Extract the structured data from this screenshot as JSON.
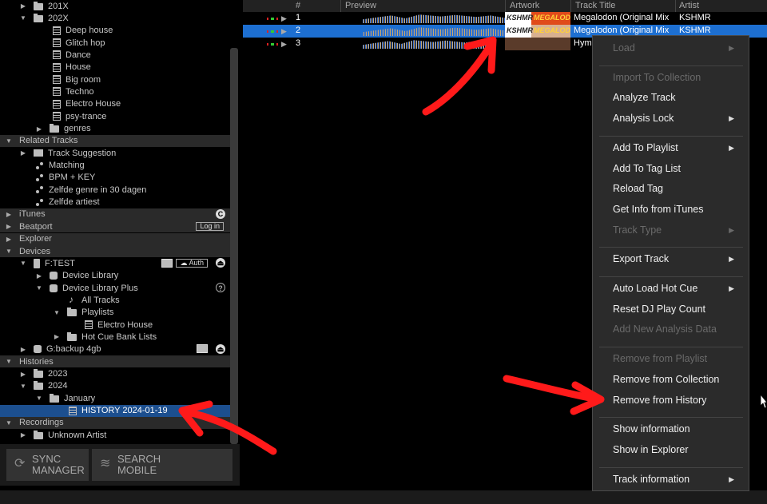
{
  "tree": {
    "rows": [
      {
        "indent": 24,
        "tri": "▶",
        "icon": "folder",
        "label": "201X"
      },
      {
        "indent": 24,
        "tri": "▼",
        "icon": "folder",
        "label": "202X"
      },
      {
        "indent": 66,
        "tri": "",
        "icon": "list",
        "label": "Deep house"
      },
      {
        "indent": 66,
        "tri": "",
        "icon": "list",
        "label": "Glitch hop"
      },
      {
        "indent": 66,
        "tri": "",
        "icon": "list",
        "label": "Dance"
      },
      {
        "indent": 66,
        "tri": "",
        "icon": "list",
        "label": "House"
      },
      {
        "indent": 66,
        "tri": "",
        "icon": "list",
        "label": "Big room"
      },
      {
        "indent": 66,
        "tri": "",
        "icon": "list",
        "label": "Techno"
      },
      {
        "indent": 66,
        "tri": "",
        "icon": "list",
        "label": "Electro House"
      },
      {
        "indent": 66,
        "tri": "",
        "icon": "list",
        "label": "psy-trance"
      },
      {
        "indent": 44,
        "tri": "▶",
        "icon": "folder",
        "label": "genres"
      },
      {
        "indent": 10,
        "tri": "▼",
        "icon": "",
        "label": "Related Tracks",
        "section": true
      },
      {
        "indent": 24,
        "tri": "▶",
        "icon": "sugg",
        "label": "Track Suggestion"
      },
      {
        "indent": 44,
        "tri": "",
        "icon": "node",
        "label": "Matching"
      },
      {
        "indent": 44,
        "tri": "",
        "icon": "node",
        "label": "BPM + KEY"
      },
      {
        "indent": 44,
        "tri": "",
        "icon": "node",
        "label": "Zelfde genre in 30 dagen"
      },
      {
        "indent": 44,
        "tri": "",
        "icon": "node",
        "label": "Zelfde artiest"
      },
      {
        "indent": 10,
        "tri": "▶",
        "icon": "",
        "label": "iTunes",
        "section": true,
        "badge": "itunes"
      },
      {
        "indent": 10,
        "tri": "▶",
        "icon": "",
        "label": "Beatport",
        "section": true,
        "badge": "login"
      },
      {
        "indent": 10,
        "tri": "▶",
        "icon": "",
        "label": "Explorer",
        "section": true
      },
      {
        "indent": 10,
        "tri": "▼",
        "icon": "",
        "label": "Devices",
        "section": true
      },
      {
        "indent": 24,
        "tri": "▼",
        "icon": "usb",
        "label": "F:TEST",
        "badge": "device"
      },
      {
        "indent": 44,
        "tri": "▶",
        "icon": "db",
        "label": "Device Library"
      },
      {
        "indent": 44,
        "tri": "▼",
        "icon": "db",
        "label": "Device Library Plus",
        "badge": "help"
      },
      {
        "indent": 86,
        "tri": "",
        "icon": "note",
        "label": "All Tracks"
      },
      {
        "indent": 66,
        "tri": "▼",
        "icon": "folder",
        "label": "Playlists"
      },
      {
        "indent": 106,
        "tri": "",
        "icon": "list",
        "label": "Electro House"
      },
      {
        "indent": 66,
        "tri": "▶",
        "icon": "folder",
        "label": "Hot Cue Bank Lists"
      },
      {
        "indent": 24,
        "tri": "▶",
        "icon": "db",
        "label": "G:backup 4gb",
        "badge": "device2"
      },
      {
        "indent": 10,
        "tri": "▼",
        "icon": "",
        "label": "Histories",
        "section": true
      },
      {
        "indent": 24,
        "tri": "▶",
        "icon": "folder",
        "label": "2023"
      },
      {
        "indent": 24,
        "tri": "▼",
        "icon": "folder",
        "label": "2024"
      },
      {
        "indent": 44,
        "tri": "▼",
        "icon": "folder",
        "label": "January"
      },
      {
        "indent": 86,
        "tri": "",
        "icon": "list",
        "label": "HISTORY 2024-01-19",
        "selected": true
      },
      {
        "indent": 10,
        "tri": "▼",
        "icon": "",
        "label": "Recordings",
        "section": true
      },
      {
        "indent": 24,
        "tri": "▶",
        "icon": "folder",
        "label": "Unknown Artist"
      }
    ],
    "login_label": "Log in",
    "auth_label": "Auth"
  },
  "bottom": {
    "sync_label_1": "SYNC",
    "sync_label_2": "MANAGER",
    "search_label_1": "SEARCH",
    "search_label_2": "MOBILE"
  },
  "table": {
    "headers": {
      "num": "#",
      "preview": "Preview",
      "artwork": "Artwork",
      "title": "Track Title",
      "artist": "Artist"
    },
    "rows": [
      {
        "num": "1",
        "title": "Megalodon (Original Mix",
        "artist": "KSHMR",
        "selected": false
      },
      {
        "num": "2",
        "title": "Megalodon (Original Mix",
        "artist": "KSHMR",
        "selected": true
      },
      {
        "num": "3",
        "title": "Hym",
        "artist": "",
        "selected": false
      }
    ],
    "artwork_text_1": "KSHMR",
    "artwork_text_2": "MEGALODON"
  },
  "menu": {
    "items": [
      {
        "label": "Load",
        "disabled": true,
        "submenu": true
      },
      {
        "sep": true
      },
      {
        "label": "Import To Collection",
        "disabled": true
      },
      {
        "label": "Analyze Track"
      },
      {
        "label": "Analysis Lock",
        "submenu": true
      },
      {
        "sep": true
      },
      {
        "label": "Add To Playlist",
        "submenu": true
      },
      {
        "label": "Add To Tag List"
      },
      {
        "label": "Reload Tag"
      },
      {
        "label": "Get Info from iTunes"
      },
      {
        "label": "Track Type",
        "disabled": true,
        "submenu": true
      },
      {
        "sep": true
      },
      {
        "label": "Export Track",
        "submenu": true
      },
      {
        "sep": true
      },
      {
        "label": "Auto Load Hot Cue",
        "submenu": true
      },
      {
        "label": "Reset DJ Play Count"
      },
      {
        "label": "Add New Analysis Data",
        "disabled": true
      },
      {
        "sep": true
      },
      {
        "label": "Remove from Playlist",
        "disabled": true
      },
      {
        "label": "Remove from Collection"
      },
      {
        "label": "Remove from History"
      },
      {
        "sep": true
      },
      {
        "label": "Show information"
      },
      {
        "label": "Show in Explorer"
      },
      {
        "sep": true
      },
      {
        "label": "Track information",
        "submenu": true
      }
    ]
  },
  "colors": {
    "selection": "#1d6fd1",
    "tree_selection": "#1c4f8f",
    "arrow": "#ff1a1a"
  }
}
